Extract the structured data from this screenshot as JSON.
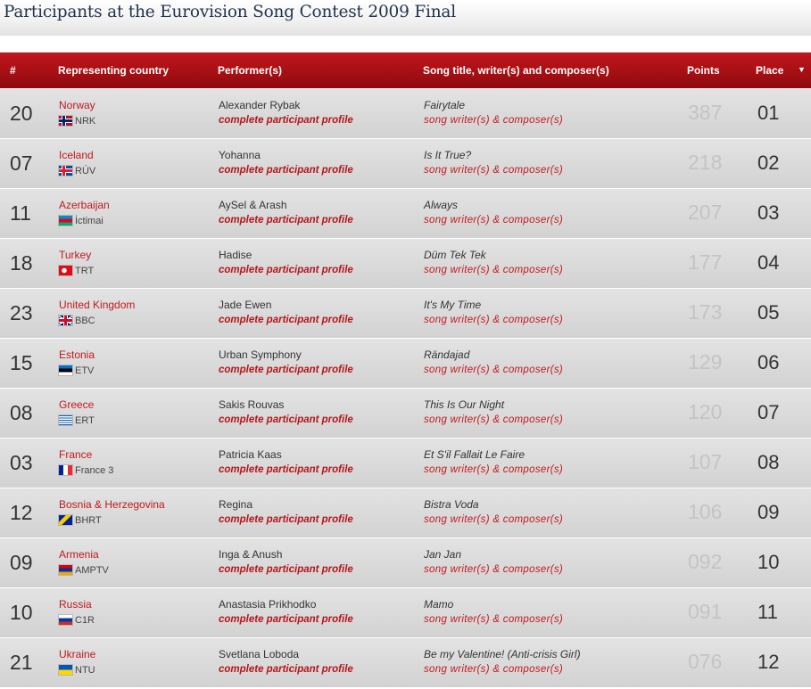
{
  "page": {
    "title": "Participants at the Eurovision Song Contest 2009 Final"
  },
  "table": {
    "headers": {
      "num": "#",
      "country": "Representing country",
      "performer": "Performer(s)",
      "song": "Song title, writer(s) and composer(s)",
      "points": "Points",
      "place": "Place",
      "sort_icon": "sort-down-icon"
    },
    "profile_link_label": "complete participant profile",
    "writers_link_label": "song writer(s) & composer(s)",
    "rows": [
      {
        "num": "20",
        "country": "Norway",
        "broadcaster": "NRK",
        "flag": "flag-norway-icon",
        "performer": "Alexander Rybak",
        "song": "Fairytale",
        "points": "387",
        "place": "01"
      },
      {
        "num": "07",
        "country": "Iceland",
        "broadcaster": "RÚV",
        "flag": "flag-iceland-icon",
        "performer": "Yohanna",
        "song": "Is It True?",
        "points": "218",
        "place": "02"
      },
      {
        "num": "11",
        "country": "Azerbaijan",
        "broadcaster": "İctimai",
        "flag": "flag-azerbaijan-icon",
        "performer": "AySel & Arash",
        "song": "Always",
        "points": "207",
        "place": "03"
      },
      {
        "num": "18",
        "country": "Turkey",
        "broadcaster": "TRT",
        "flag": "flag-turkey-icon",
        "performer": "Hadise",
        "song": "Düm Tek Tek",
        "points": "177",
        "place": "04"
      },
      {
        "num": "23",
        "country": "United Kingdom",
        "broadcaster": "BBC",
        "flag": "flag-uk-icon",
        "performer": "Jade Ewen",
        "song": "It's My Time",
        "points": "173",
        "place": "05"
      },
      {
        "num": "15",
        "country": "Estonia",
        "broadcaster": "ETV",
        "flag": "flag-estonia-icon",
        "performer": "Urban Symphony",
        "song": "Rändajad",
        "points": "129",
        "place": "06"
      },
      {
        "num": "08",
        "country": "Greece",
        "broadcaster": "ERT",
        "flag": "flag-greece-icon",
        "performer": "Sakis Rouvas",
        "song": "This Is Our Night",
        "points": "120",
        "place": "07"
      },
      {
        "num": "03",
        "country": "France",
        "broadcaster": "France 3",
        "flag": "flag-france-icon",
        "performer": "Patricia Kaas",
        "song": "Et S'il Fallait Le Faire",
        "points": "107",
        "place": "08"
      },
      {
        "num": "12",
        "country": "Bosnia & Herzegovina",
        "broadcaster": "BHRT",
        "flag": "flag-bosnia-icon",
        "performer": "Regina",
        "song": "Bistra Voda",
        "points": "106",
        "place": "09"
      },
      {
        "num": "09",
        "country": "Armenia",
        "broadcaster": "AMPTV",
        "flag": "flag-armenia-icon",
        "performer": "Inga & Anush",
        "song": "Jan Jan",
        "points": "092",
        "place": "10"
      },
      {
        "num": "10",
        "country": "Russia",
        "broadcaster": "C1R",
        "flag": "flag-russia-icon",
        "performer": "Anastasia Prikhodko",
        "song": "Mamo",
        "points": "091",
        "place": "11"
      },
      {
        "num": "21",
        "country": "Ukraine",
        "broadcaster": "NTU",
        "flag": "flag-ukraine-icon",
        "performer": "Svetlana Loboda",
        "song": "Be my Valentine! (Anti-crisis Girl)",
        "points": "076",
        "place": "12"
      }
    ]
  }
}
